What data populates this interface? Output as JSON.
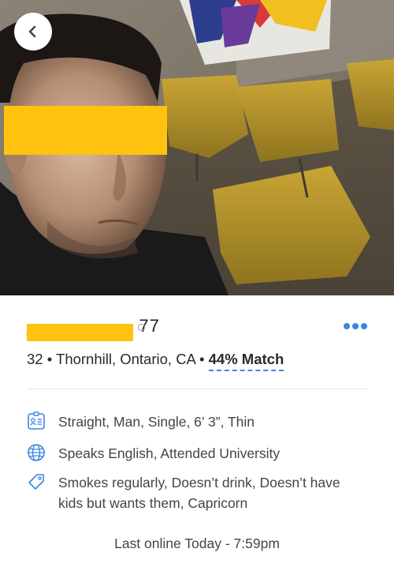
{
  "header": {
    "back_icon": "chevron-left-icon"
  },
  "profile": {
    "username": "_ _ _ _ _ _ _ 77",
    "age": "32",
    "separator": "•",
    "location": "Thornhill, Ontario, CA",
    "match": "44% Match",
    "more_icon": "more-dots-icon",
    "accent_color": "#3a86e0",
    "redaction_color": "#ffc20e"
  },
  "details": [
    {
      "icon": "id-card-icon",
      "text": "Straight, Man, Single, 6’ 3”, Thin"
    },
    {
      "icon": "globe-icon",
      "text": "Speaks English, Attended University"
    },
    {
      "icon": "tag-icon",
      "text": "Smokes regularly, Doesn’t drink, Doesn’t have kids but wants them, Capricorn"
    }
  ],
  "status": {
    "last_online": "Last online Today - 7:59pm"
  }
}
